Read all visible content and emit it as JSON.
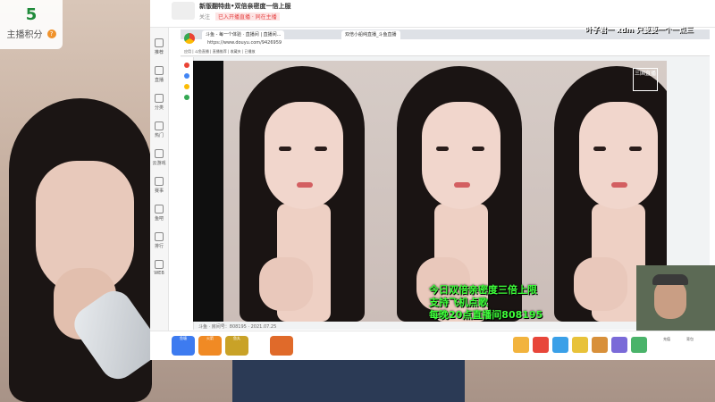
{
  "score_widget": {
    "value": "5",
    "label": "主播积分",
    "badge": "?"
  },
  "stream_header": {
    "title": "新版翻特曲•双倍亲密度一倍上服",
    "meta": "关注",
    "tag": "已入开播直播 · 同在主播"
  },
  "sidebar": {
    "items": [
      "关注",
      "推荐",
      "直播",
      "分类",
      "热门",
      "云游戏",
      "赛事",
      "鱼吧",
      "排行",
      "WEB"
    ]
  },
  "browser": {
    "tabs": [
      "斗鱼 - 每一个体验 · 直播间 | 直播间...",
      "双倍小船纯直播_斗鱼直播"
    ],
    "url": "https://www.douyu.com/9426959",
    "bookmarks": "应用  |  斗鱼直播  |  直播推荐  |  收藏夹  |  已播放"
  },
  "video": {
    "overlay_lines": [
      "今日双倍亲密度三倍上限",
      "支持飞机点歌",
      "每晚20点直播间808195"
    ],
    "room_id_text": "斗鱼 · 房间号：808195 · 2021.07.25",
    "watermark": "三国直播"
  },
  "danmaku": {
    "line1": "叶子君一  xdm  只要要一个一点三",
    "line2": "xdm 只要要一个一点三"
  },
  "gift_bar": {
    "left_labels": [
      "鱼塘",
      "火箭",
      "鱼丸"
    ],
    "right_labels": [
      "充值",
      "背包"
    ]
  },
  "colors": {
    "overlay_green": "#3eff3a",
    "score_green": "#1f8a3a",
    "accent_red": "#e53e3e"
  }
}
